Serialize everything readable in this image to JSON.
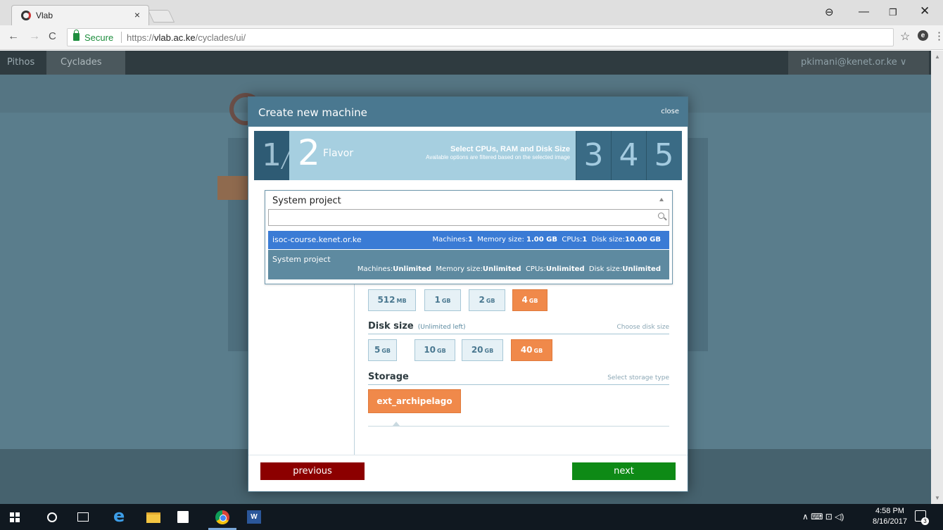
{
  "browser": {
    "tab_title": "Vlab",
    "tab_close": "×",
    "secure_label": "Secure",
    "url_scheme": "https://",
    "url_host": "vlab.ac.ke",
    "url_path": "/cyclades/ui/",
    "profile_glyph": "⊖",
    "min_glyph": "—",
    "max_glyph": "❐",
    "close_glyph": "✕",
    "back_glyph": "←",
    "forward_glyph": "→",
    "reload_glyph": "C",
    "star_glyph": "☆",
    "ext_glyph": "e",
    "menu_glyph": "⋮"
  },
  "app": {
    "nav_pithos": "Pithos",
    "nav_cyclades": "Cyclades",
    "user": "pkimani@kenet.or.ke ∨"
  },
  "modal": {
    "title": "Create new machine",
    "close_label": "close",
    "steps": {
      "step1": "1",
      "step2_num": "2",
      "step2_title": "Flavor",
      "step2_desc_line1": "Select CPUs, RAM and Disk Size",
      "step2_desc_line2": "Available options are filtered based on the selected image",
      "step3": "3",
      "step4": "4",
      "step5": "5"
    },
    "project_dropdown": {
      "selected": "System project",
      "search_value": "",
      "options": [
        {
          "name": "isoc-course.kenet.or.ke",
          "machines_label": "Machines:",
          "machines": "1",
          "memory_label": "Memory size:",
          "memory": "1.00 GB",
          "cpus_label": "CPUs:",
          "cpus": "1",
          "disk_label": "Disk size:",
          "disk": "10.00 GB"
        },
        {
          "name": "System project",
          "machines_label": "Machines:",
          "machines": "Unlimited",
          "memory_label": "Memory size:",
          "memory": "Unlimited",
          "cpus_label": "CPUs:",
          "cpus": "Unlimited",
          "disk_label": "Disk size:",
          "disk": "Unlimited"
        }
      ]
    },
    "memory": {
      "options": [
        {
          "value": "512",
          "unit": "MB",
          "selected": false
        },
        {
          "value": "1",
          "unit": "GB",
          "selected": false
        },
        {
          "value": "2",
          "unit": "GB",
          "selected": false
        },
        {
          "value": "4",
          "unit": "GB",
          "selected": true
        }
      ]
    },
    "disk": {
      "title": "Disk size",
      "subtitle": "(Unlimited left)",
      "hint": "Choose disk size",
      "options": [
        {
          "value": "5",
          "unit": "GB",
          "selected": false
        },
        {
          "value": "10",
          "unit": "GB",
          "selected": false
        },
        {
          "value": "20",
          "unit": "GB",
          "selected": false
        },
        {
          "value": "40",
          "unit": "GB",
          "selected": true
        }
      ]
    },
    "storage": {
      "title": "Storage",
      "hint": "Select storage type",
      "selected": "ext_archipelago"
    },
    "previous_label": "previous",
    "next_label": "next"
  },
  "taskbar": {
    "edge_glyph": "e",
    "word_glyph": "W",
    "tray": "∧  ⌨  ⊡  ◁)",
    "time": "4:58 PM",
    "date": "8/16/2017",
    "notifications": "3"
  },
  "colors": {
    "modal_header": "#4a7890",
    "selected_option": "#f0894a",
    "previous_button": "#8c0000",
    "next_button": "#0e8a16",
    "dropdown_highlight": "#3a7bd5"
  }
}
